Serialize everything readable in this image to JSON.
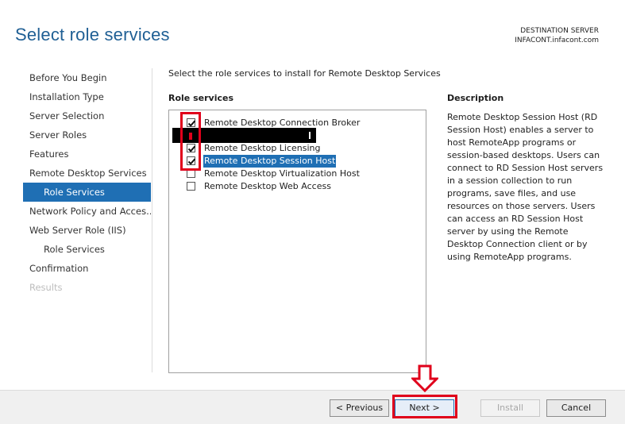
{
  "page": {
    "title": "Select role services",
    "destination_label": "DESTINATION SERVER",
    "destination_value": "INFACONT.infacont.com"
  },
  "nav": {
    "items": [
      {
        "label": "Before You Begin",
        "state": "normal",
        "indent": 0
      },
      {
        "label": "Installation Type",
        "state": "normal",
        "indent": 0
      },
      {
        "label": "Server Selection",
        "state": "normal",
        "indent": 0
      },
      {
        "label": "Server Roles",
        "state": "normal",
        "indent": 0
      },
      {
        "label": "Features",
        "state": "normal",
        "indent": 0
      },
      {
        "label": "Remote Desktop Services",
        "state": "normal",
        "indent": 0
      },
      {
        "label": "Role Services",
        "state": "active",
        "indent": 1
      },
      {
        "label": "Network Policy and Acces...",
        "state": "normal",
        "indent": 0
      },
      {
        "label": "Web Server Role (IIS)",
        "state": "normal",
        "indent": 0
      },
      {
        "label": "Role Services",
        "state": "normal",
        "indent": 1
      },
      {
        "label": "Confirmation",
        "state": "normal",
        "indent": 0
      },
      {
        "label": "Results",
        "state": "disabled",
        "indent": 0
      }
    ]
  },
  "main": {
    "instruction": "Select the role services to install for Remote Desktop Services",
    "role_services_heading": "Role services",
    "role_services": [
      {
        "label": "Remote Desktop Connection Broker",
        "checked": true,
        "highlighted": false
      },
      {
        "label": "Remote Desktop Licensing",
        "checked": true,
        "highlighted": false
      },
      {
        "label": "Remote Desktop Session Host",
        "checked": true,
        "highlighted": true
      },
      {
        "label": "Remote Desktop Virtualization Host",
        "checked": false,
        "highlighted": false
      },
      {
        "label": "Remote Desktop Web Access",
        "checked": false,
        "highlighted": false
      }
    ],
    "description_heading": "Description",
    "description": "Remote Desktop Session Host (RD Session Host) enables a server to host RemoteApp programs or session-based desktops. Users can connect to RD Session Host servers in a session collection to run programs, save files, and use resources on those servers. Users can access an RD Session Host server by using the Remote Desktop Connection client or by using RemoteApp programs."
  },
  "footer": {
    "previous_label": "< Previous",
    "next_label": "Next >",
    "install_label": "Install",
    "cancel_label": "Cancel"
  },
  "colors": {
    "accent": "#1f6fb4",
    "title": "#1f5f94",
    "annotation": "#e0001b"
  }
}
